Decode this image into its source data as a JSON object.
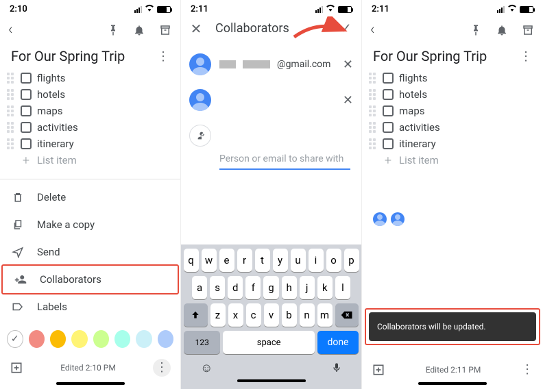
{
  "screen1": {
    "status_time": "2:10",
    "note_title": "For Our Spring Trip",
    "items": [
      "flights",
      "hotels",
      "maps",
      "activities",
      "itinerary"
    ],
    "add_item": "List item",
    "menu": {
      "delete": "Delete",
      "copy": "Make a copy",
      "send": "Send",
      "collab": "Collaborators",
      "labels": "Labels"
    },
    "colors": [
      "#ffffff",
      "#f28b82",
      "#fbbc04",
      "#fff475",
      "#ccff90",
      "#a7ffeb",
      "#cbf0f8",
      "#aecbfa"
    ],
    "footer_edited": "Edited 2:10 PM"
  },
  "screen2": {
    "status_time": "2:11",
    "title": "Collaborators",
    "email_suffix": "@gmail.com",
    "input_placeholder": "Person or email to share with",
    "keys_r1": [
      "q",
      "w",
      "e",
      "r",
      "t",
      "y",
      "u",
      "i",
      "o",
      "p"
    ],
    "keys_r2": [
      "a",
      "s",
      "d",
      "f",
      "g",
      "h",
      "j",
      "k",
      "l"
    ],
    "keys_r3": [
      "z",
      "x",
      "c",
      "v",
      "b",
      "n",
      "m"
    ],
    "k123": "123",
    "kspace": "space",
    "kdone": "done"
  },
  "screen3": {
    "status_time": "2:11",
    "note_title": "For Our Spring Trip",
    "items": [
      "flights",
      "hotels",
      "maps",
      "activities",
      "itinerary"
    ],
    "add_item": "List item",
    "toast": "Collaborators will be updated.",
    "footer_edited": "Edited 2:11 PM"
  }
}
